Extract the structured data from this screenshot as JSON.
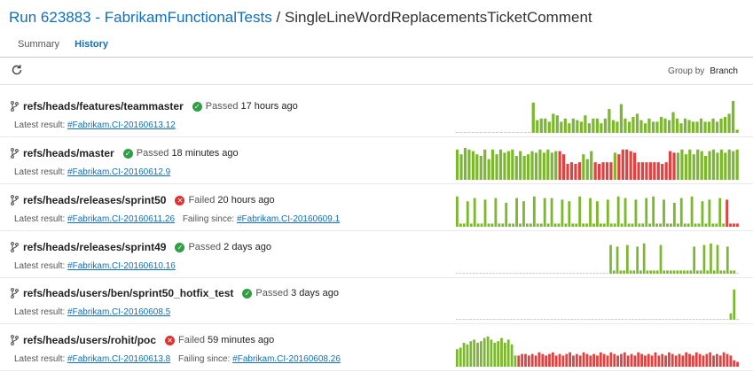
{
  "header": {
    "run_link": "Run 623883 - FabrikamFunctionalTests",
    "separator": " / ",
    "test_name": "SingleLineWordReplacementsTicketComment"
  },
  "tabs": [
    {
      "label": "Summary",
      "active": false
    },
    {
      "label": "History",
      "active": true
    }
  ],
  "toolbar": {
    "refresh_icon": "refresh-icon",
    "group_by_label": "Group by",
    "group_by_value": "Branch"
  },
  "colors": {
    "link": "#106ebe",
    "passed": "#7cb82f",
    "failed": "#e34040",
    "empty": "#cccccc"
  },
  "rows": [
    {
      "branch": "refs/heads/features/teammaster",
      "status": "Passed",
      "status_type": "pass",
      "when": "17 hours ago",
      "latest_label": "Latest result:",
      "latest_link": "#Fabrikam.CI-20160613.12",
      "failing_since_label": "",
      "failing_since_link": "",
      "history": "eeeeeeeeeeeeeeeeeeepppppppppppppppppppppppppppppppppppppppppppppppppppppppppppppppppp",
      "heights": [
        0,
        0,
        0,
        0,
        0,
        0,
        0,
        0,
        0,
        0,
        0,
        0,
        0,
        0,
        0,
        0,
        0,
        0,
        0,
        0.95,
        0.4,
        0.45,
        0.45,
        0.35,
        0.6,
        0.55,
        0.35,
        0.45,
        0.3,
        0.45,
        0.4,
        0.35,
        0.55,
        0.3,
        0.45,
        0.45,
        0.3,
        0.45,
        0.75,
        0.4,
        0.35,
        0.9,
        0.45,
        0.35,
        0.5,
        0.6,
        0.4,
        0.3,
        0.45,
        0.35,
        0.35,
        0.5,
        0.45,
        0.4,
        0.65,
        0.45,
        0.3,
        0.45,
        0.4,
        0.35,
        0.35,
        0.45,
        0.35,
        0.35,
        0.45,
        0.35,
        0.45,
        0.5,
        0.6,
        1.0,
        0.1
      ]
    },
    {
      "branch": "refs/heads/master",
      "status": "Passed",
      "status_type": "pass",
      "when": "18 minutes ago",
      "latest_label": "Latest result:",
      "latest_link": "#Fabrikam.CI-20160612.9",
      "failing_since_label": "",
      "failing_since_link": "",
      "history": "ppppppppppppppppppppppppppffffffpppfffffpfffffffffffffffppppppppppppppppppppppppp",
      "heights": [
        0.95,
        0.8,
        1.0,
        0.95,
        0.9,
        0.8,
        0.75,
        0.95,
        0.65,
        0.95,
        0.8,
        0.95,
        0.85,
        0.9,
        0.95,
        0.75,
        0.9,
        0.75,
        0.8,
        0.9,
        0.85,
        0.95,
        0.85,
        0.95,
        0.85,
        0.9,
        0.9,
        0.8,
        0.5,
        0.55,
        0.5,
        0.55,
        0.8,
        0.65,
        0.9,
        0.55,
        0.5,
        0.55,
        0.55,
        0.55,
        0.85,
        0.8,
        0.95,
        0.95,
        0.9,
        0.85,
        0.55,
        0.55,
        0.55,
        0.55,
        0.55,
        0.55,
        0.5,
        0.55,
        0.9,
        0.85,
        0.85,
        0.95,
        0.8,
        0.95,
        0.8,
        0.95,
        0.9,
        0.75,
        0.9,
        0.95,
        0.85,
        0.95,
        0.85,
        0.95,
        0.9,
        0.95
      ]
    },
    {
      "branch": "refs/heads/releases/sprint50",
      "status": "Failed",
      "status_type": "fail",
      "when": "20 hours ago",
      "latest_label": "Latest result:",
      "latest_link": "#Fabrikam.CI-20160611.26",
      "failing_since_label": "Failing since:",
      "failing_since_link": "#Fabrikam.CI-20160609.1",
      "history": "pppppppppppppppppppppppppppppppppppppppppppppppppppppppppppppppppppppppppppppffff",
      "heights": [
        0.95,
        0.1,
        0.1,
        0.8,
        0.1,
        0.9,
        0.1,
        0.1,
        0.85,
        0.1,
        0.1,
        0.9,
        0.1,
        0.1,
        0.75,
        0.1,
        0.1,
        0.9,
        0.1,
        0.8,
        0.1,
        0.1,
        0.95,
        0.1,
        0.1,
        0.9,
        0.1,
        0.9,
        0.1,
        0.1,
        0.85,
        0.1,
        0.8,
        0.1,
        0.1,
        0.95,
        0.1,
        0.1,
        0.9,
        0.1,
        0.8,
        0.1,
        0.1,
        0.85,
        0.1,
        0.1,
        0.95,
        0.1,
        0.9,
        0.1,
        0.1,
        0.85,
        0.1,
        0.1,
        0.9,
        0.1,
        0.95,
        0.1,
        0.1,
        0.85,
        0.1,
        0.1,
        0.75,
        0.1,
        0.9,
        0.1,
        0.1,
        0.95,
        0.1,
        0.1,
        0.8,
        0.1,
        0.85,
        0.1,
        0.1,
        0.9,
        0.1,
        0.85,
        0.1,
        0.1,
        0.1
      ]
    },
    {
      "branch": "refs/heads/releases/sprint49",
      "status": "Passed",
      "status_type": "pass",
      "when": "2 days ago",
      "latest_label": "Latest result:",
      "latest_link": "#Fabrikam.CI-20160610.16",
      "failing_since_label": "",
      "failing_since_link": "",
      "history": "eeeeeeeeeeeeeeeeeeeeeeeeeeeeeeeeeeeeeeeeeeeeeepppppppppppppppppppppppppppppppppppppp",
      "heights": [
        0,
        0,
        0,
        0,
        0,
        0,
        0,
        0,
        0,
        0,
        0,
        0,
        0,
        0,
        0,
        0,
        0,
        0,
        0,
        0,
        0,
        0,
        0,
        0,
        0,
        0,
        0,
        0,
        0,
        0,
        0,
        0,
        0,
        0,
        0,
        0,
        0,
        0,
        0,
        0,
        0,
        0,
        0,
        0,
        0,
        0,
        0.9,
        0.1,
        0.85,
        0.1,
        0.1,
        0.9,
        0.1,
        0.1,
        0.85,
        0.1,
        0.95,
        0.1,
        0.1,
        0.1,
        0.1,
        0.9,
        0.1,
        0.1,
        0.1,
        0.1,
        0.1,
        0.1,
        0.1,
        0.1,
        0.1,
        0.85,
        0.1,
        0.1,
        0.9,
        0.1,
        0.95,
        0.1,
        0.9,
        0.1,
        0.1,
        0.85,
        0.1,
        0.1,
        0.95
      ]
    },
    {
      "branch": "refs/heads/users/ben/sprint50_hotfix_test",
      "status": "Passed",
      "status_type": "pass",
      "when": "3 days ago",
      "latest_label": "Latest result:",
      "latest_link": "#Fabrikam.CI-20160608.5",
      "failing_since_label": "",
      "failing_since_link": "",
      "history": "eeeeeeeeeeeeeeeeeeeeeeeeeeeeeeeeeeeeeeeeeeeeeeeeeeeeeeeeeeeeeeeeeeeeeeeeeeeeeeeeppp",
      "heights": [
        0,
        0,
        0,
        0,
        0,
        0,
        0,
        0,
        0,
        0,
        0,
        0,
        0,
        0,
        0,
        0,
        0,
        0,
        0,
        0,
        0,
        0,
        0,
        0,
        0,
        0,
        0,
        0,
        0,
        0,
        0,
        0,
        0,
        0,
        0,
        0,
        0,
        0,
        0,
        0,
        0,
        0,
        0,
        0,
        0,
        0,
        0,
        0,
        0,
        0,
        0,
        0,
        0,
        0,
        0,
        0,
        0,
        0,
        0,
        0,
        0,
        0,
        0,
        0,
        0,
        0,
        0,
        0,
        0,
        0,
        0,
        0,
        0,
        0,
        0,
        0,
        0,
        0,
        0,
        0,
        0,
        0.2,
        0.95,
        0.1
      ]
    },
    {
      "branch": "refs/heads/users/rohit/poc",
      "status": "Failed",
      "status_type": "fail",
      "when": "59 minutes ago",
      "latest_label": "Latest result:",
      "latest_link": "#Fabrikam.CI-20160613.8",
      "failing_since_label": "Failing since:",
      "failing_since_link": "#Fabrikam.CI-20160608.26",
      "history": "ppppppppppppppppppfffffffffffffffffffffffffffffffffffffffffffffffffffffffffffffffffff",
      "heights": [
        0.55,
        0.6,
        0.75,
        0.7,
        0.8,
        0.85,
        0.75,
        0.8,
        0.9,
        0.95,
        0.85,
        0.75,
        0.8,
        0.9,
        0.75,
        0.85,
        0.7,
        0.35,
        0.35,
        0.4,
        0.4,
        0.35,
        0.4,
        0.35,
        0.45,
        0.4,
        0.35,
        0.4,
        0.45,
        0.35,
        0.4,
        0.35,
        0.4,
        0.45,
        0.35,
        0.4,
        0.35,
        0.45,
        0.4,
        0.35,
        0.4,
        0.35,
        0.45,
        0.4,
        0.35,
        0.45,
        0.4,
        0.35,
        0.4,
        0.45,
        0.35,
        0.4,
        0.35,
        0.45,
        0.4,
        0.35,
        0.4,
        0.35,
        0.45,
        0.35,
        0.4,
        0.35,
        0.45,
        0.4,
        0.35,
        0.4,
        0.35,
        0.45,
        0.4,
        0.35,
        0.45,
        0.4,
        0.35,
        0.4,
        0.45,
        0.35,
        0.4,
        0.35,
        0.45,
        0.4,
        0.35,
        0.2,
        0.15
      ]
    }
  ]
}
